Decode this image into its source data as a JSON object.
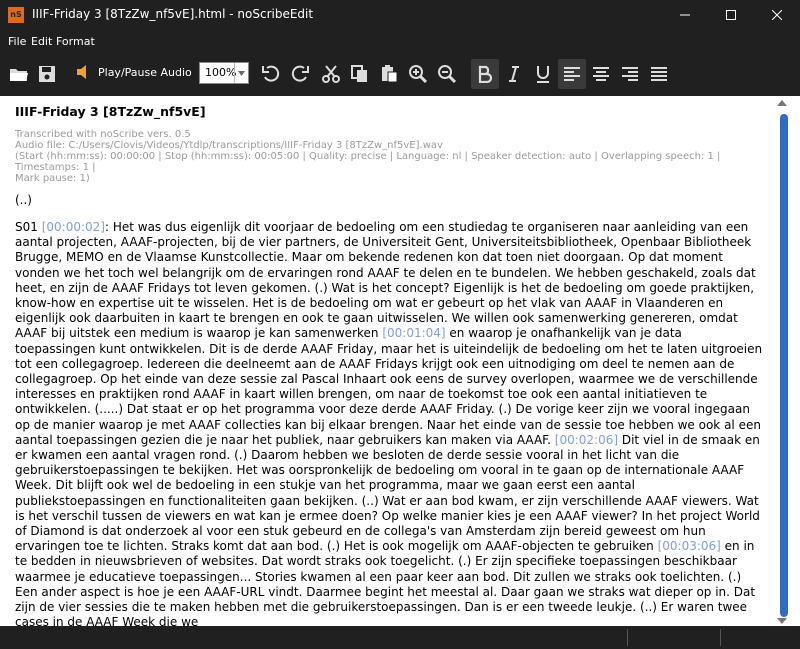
{
  "window": {
    "title": "IIIF-Friday 3 [8TzZw_nf5vE].html - noScribeEdit",
    "app_icon_text": "nS"
  },
  "menu": [
    "File",
    "Edit",
    "Format"
  ],
  "toolbar": {
    "play_pause_label": "Play/Pause Audio",
    "zoom_value": "100%"
  },
  "document": {
    "title": "IIIF-Friday 3 [8TzZw_nf5vE]",
    "meta_lines": [
      "Transcribed with noScribe vers. 0.5",
      "Audio file: C:/Users/Clovis/Videos/Ytdlp/transcriptions/IIIF-Friday 3 [8TzZw_nf5vE].wav",
      "(Start (hh:mm:ss): 00:00:00 | Stop (hh:mm:ss): 00:05:00 | Quality: precise | Language: nl | Speaker detection: auto | Overlapping speech: 1 | Timestamps: 1 |",
      "Mark pause: 1)"
    ],
    "ellipsis": "(..)",
    "speaker": "S01",
    "ts1": "[00:00:02]",
    "seg1": ": Het was dus eigenlijk dit voorjaar de bedoeling om een studiedag te organiseren naar aanleiding van een aantal projecten, AAAF-projecten, bij de vier partners, de Universiteit Gent, Universiteitsbibliotheek, Openbaar Bibliotheek Brugge, MEMO en de Vlaamse Kunstcollectie. Maar om bekende redenen kon dat toen niet doorgaan. Op dat moment vonden we het toch wel belangrijk om de ervaringen rond AAAF te delen en te bundelen. We hebben geschakeld, zoals dat heet, en zijn de AAAF Fridays tot leven gekomen. (.) Wat is het concept? Eigenlijk is het de bedoeling om goede praktijken, know-how en expertise uit te wisselen. Het is de bedoeling om wat er gebeurt op het vlak van AAAF in Vlaanderen en eigenlijk ook daarbuiten in kaart te brengen en ook te gaan uitwisselen. We willen ook samenwerking genereren, omdat AAAF bij uitstek een medium is waarop je kan samenwerken ",
    "ts2": "[00:01:04]",
    "seg2": " en waarop je onafhankelijk van je data toepassingen kunt ontwikkelen. Dit is de derde AAAF Friday, maar het is uiteindelijk de bedoeling om het te laten uitgroeien tot een collegagroep. Iedereen die deelneemt aan de AAAF Fridays krijgt ook een uitnodiging om deel te nemen aan de collegagroep. Op het einde van deze sessie zal Pascal Inhaart ook eens de survey overlopen, waarmee we de verschillende interesses en praktijken rond AAAF in kaart willen brengen, om naar de toekomst toe ook een aantal initiatieven te ontwikkelen. (.....) Dat staat er op het programma voor deze derde AAAF Friday. (.) De vorige keer zijn we vooral ingegaan op de manier waarop je met AAAF collecties kan bij elkaar brengen. Naar het einde van de sessie toe hebben we ook al een aantal toepassingen gezien die je naar het publiek, naar gebruikers kan maken via AAAF. ",
    "ts3": "[00:02:06]",
    "seg3": " Dit viel in de smaak en er kwamen een aantal vragen rond. (.) Daarom hebben we besloten de derde sessie vooral in het licht van die gebruikerstoepassingen te bekijken. Het was oorspronkelijk de bedoeling om vooral in te gaan op de internationale AAAF Week. Dit blijft ook wel de bedoeling in een stukje van het programma, maar we gaan eerst een aantal publiekstoepassingen en functionaliteiten gaan bekijken. (..) Wat er aan bod kwam, er zijn verschillende AAAF viewers. Wat is het verschil tussen de viewers en wat kan je ermee doen? Op welke manier kies je een AAAF viewer? In het project World of Diamond is dat onderzoek al voor een stuk gebeurd en de collega's van Amsterdam zijn bereid geweest om hun ervaringen toe te lichten. Straks komt dat aan bod. (.) Het is ook mogelijk om AAAF-objecten te gebruiken ",
    "ts4": "[00:03:06]",
    "seg4": " en in te bedden in nieuwsbrieven of websites. Dat wordt straks ook toegelicht. (.) Er zijn specifieke toepassingen beschikbaar waarmee je educatieve toepassingen... Stories kwamen al een paar keer aan bod. Dit zullen we straks ook toelichten. (.) Een ander aspect is hoe je een AAAF-URL vindt. Daarmee begint het meestal al. Daar gaan we straks wat dieper op in. Dat zijn de vier sessies die te maken hebben met die gebruikerstoepassingen. Dan is er een tweede leukje. (..) Er waren twee cases in de AAAF Week die we"
  },
  "colors": {
    "timestamp": "#7f9fd6",
    "scroll_thumb": "#2f6bc5",
    "play_icon": "#f0a030"
  }
}
